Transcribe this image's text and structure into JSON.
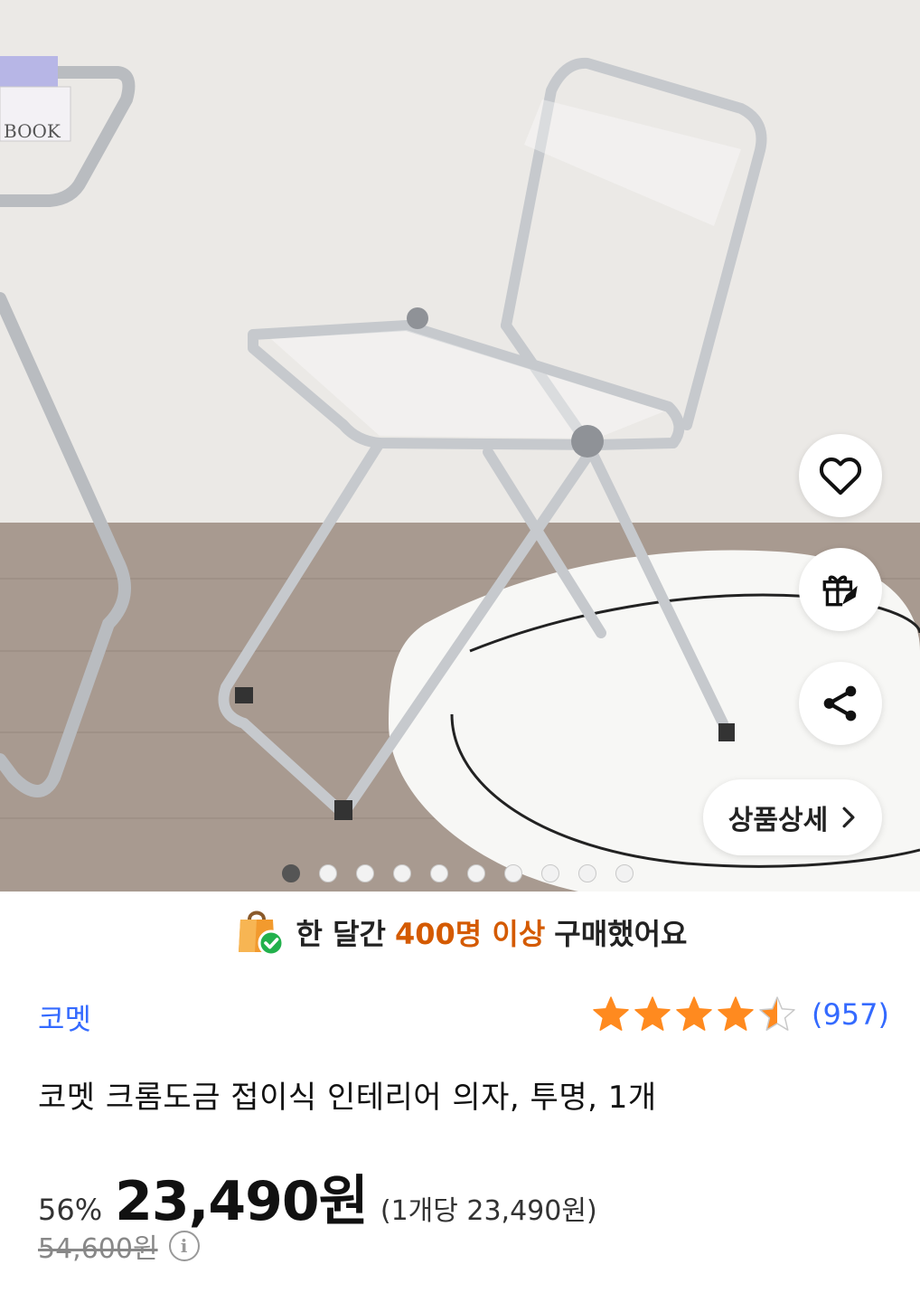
{
  "gallery": {
    "book_label": "BOOK",
    "dots_total": 10,
    "active_dot": 0
  },
  "actions": {
    "detail_label": "상품상세"
  },
  "banner": {
    "prefix": "한 달간",
    "highlight": "400명 이상",
    "suffix": "구매했어요"
  },
  "product": {
    "seller": "코멧",
    "rating_stars": 4.5,
    "review_count": "(957)",
    "title": "코멧 크롬도금 접이식 인테리어 의자, 투명, 1개",
    "discount": "56%",
    "price": "23,490원",
    "unit_price": "(1개당 23,490원)",
    "original_price": "54,600원"
  },
  "colors": {
    "accent_blue": "#346aff",
    "star": "#ff8a1f",
    "highlight_orange": "#d45a00"
  }
}
